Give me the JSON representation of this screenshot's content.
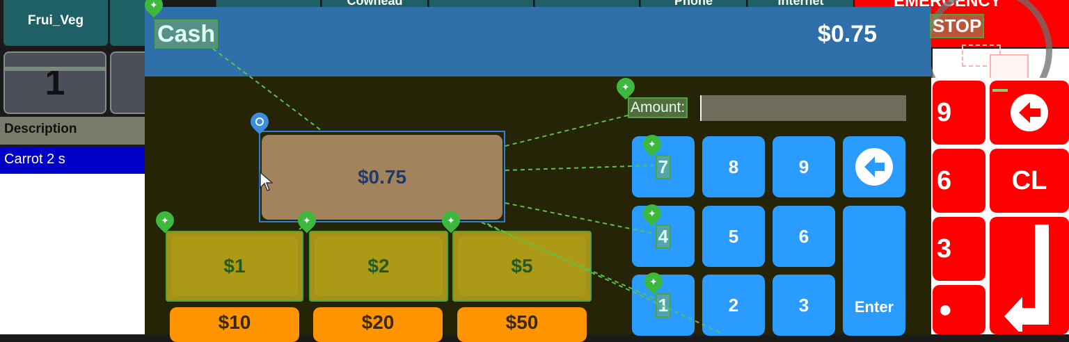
{
  "background": {
    "tile_label": "Frui_Veg",
    "top_buttons": [
      "Cowhead",
      "Phone",
      "Internet"
    ],
    "emergency_label": "EMERGENCY",
    "stop_label": "STOP",
    "quantity": "1",
    "description_header": "Description",
    "selected_row": "Carrot 2 s",
    "red_keys": [
      "9",
      "6",
      "CL",
      "3",
      "●"
    ]
  },
  "dialog": {
    "title": "Cash",
    "total": "$0.75",
    "tender_amount": "$0.75",
    "amount_label": "Amount:",
    "amount_value": "",
    "quick_amounts": [
      "$1",
      "$2",
      "$5"
    ],
    "more_amounts": [
      "$10",
      "$20",
      "$50"
    ],
    "keypad": {
      "row1": [
        "7",
        "8",
        "9"
      ],
      "row2": [
        "4",
        "5",
        "6"
      ],
      "row3": [
        "1",
        "2",
        "3"
      ],
      "enter": "Enter"
    }
  },
  "colors": {
    "header": "#2f6faa",
    "body": "#262407",
    "key_blue": "#2b9cff",
    "emergency_red": "#ff0000",
    "highlight_green": "#4fa33d"
  },
  "icons": [
    "back-arrow-icon",
    "enter-arrow-icon",
    "pushpin-icon",
    "crosshair-icon",
    "mouse-cursor-icon"
  ]
}
